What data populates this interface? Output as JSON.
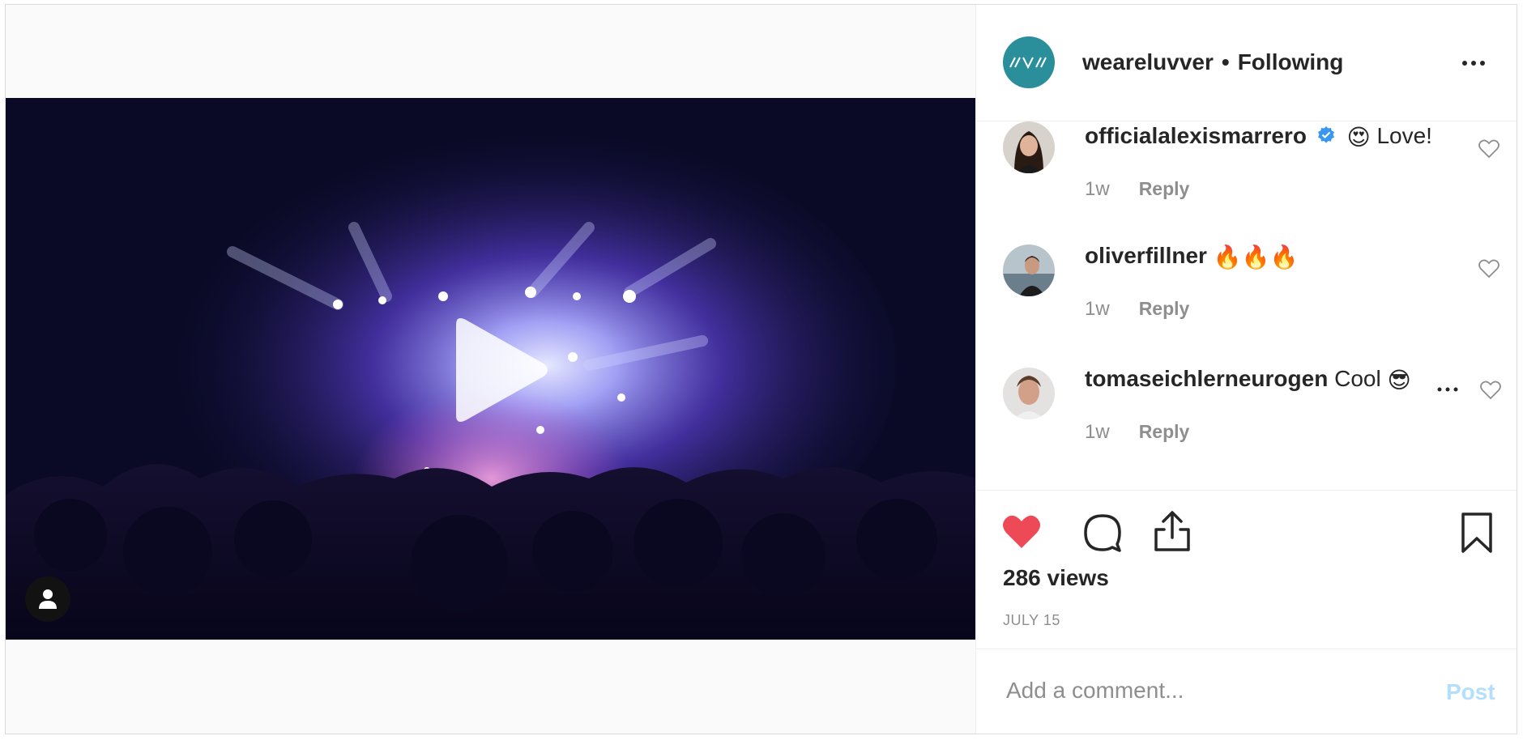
{
  "post": {
    "username": "weareluvver",
    "separator": "•",
    "follow_status": "Following",
    "views": "286 views",
    "date": "JULY 15"
  },
  "comments": [
    {
      "user": "officialalexismarrero",
      "verified": true,
      "emoji": "😍",
      "text": "Love!",
      "time": "1w",
      "reply": "Reply"
    },
    {
      "user": "oliverfillner",
      "verified": false,
      "emoji": "🔥🔥🔥",
      "text": "",
      "time": "1w",
      "reply": "Reply"
    },
    {
      "user": "tomaseichlerneurogen",
      "verified": false,
      "emoji": "😎",
      "text": "Cool",
      "time": "1w",
      "reply": "Reply"
    }
  ],
  "comment_box": {
    "placeholder": "Add a comment...",
    "post_label": "Post"
  },
  "colors": {
    "like_active": "#ed4956",
    "brand_avatar": "#2a8f9a",
    "verified": "#3897f0",
    "post_disabled": "#b2dffc"
  },
  "icons": [
    "play-icon",
    "user-tag-icon",
    "more-options-icon",
    "heart-icon",
    "comment-icon",
    "share-icon",
    "bookmark-icon",
    "verified-icon"
  ]
}
